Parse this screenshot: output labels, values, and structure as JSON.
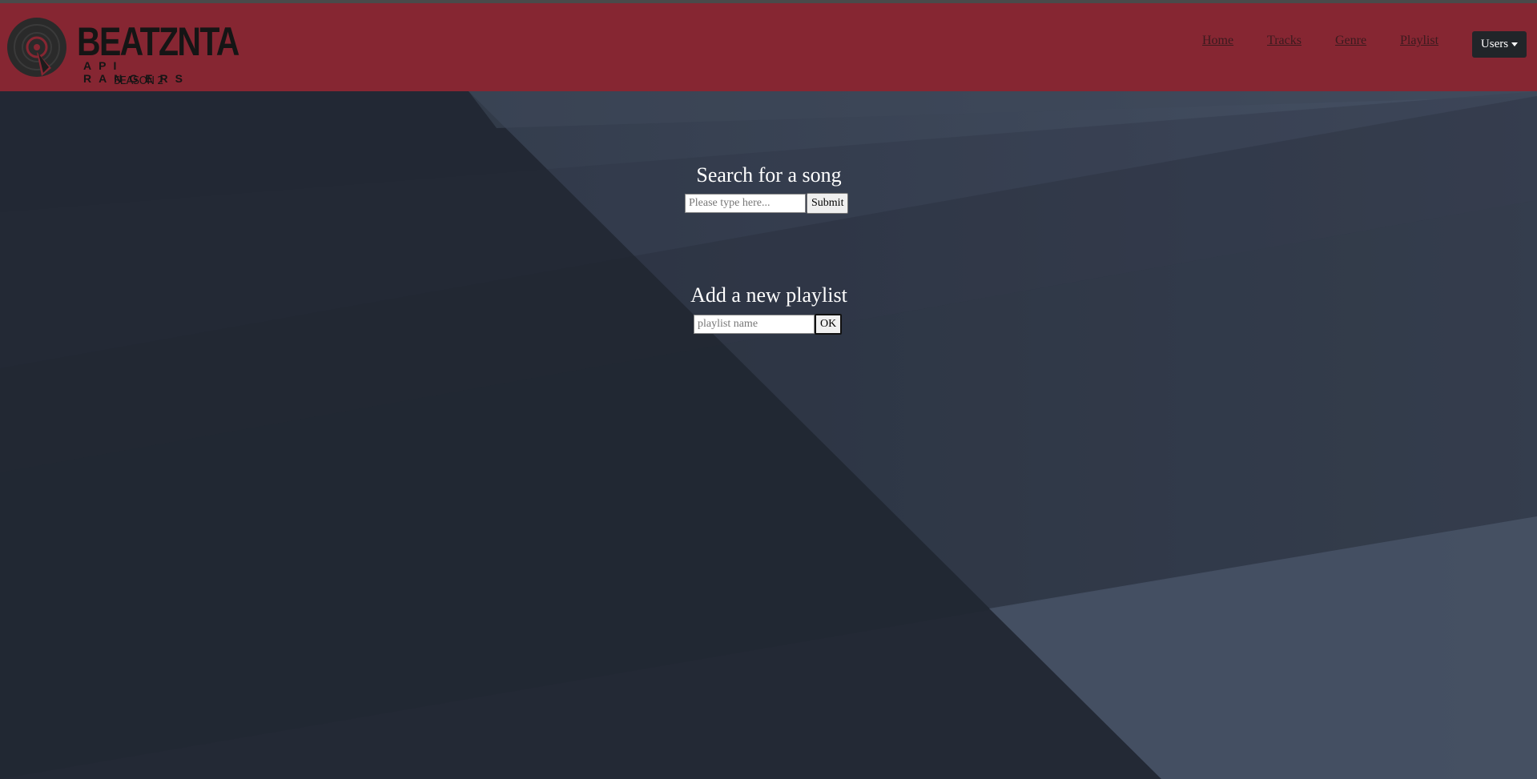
{
  "colors": {
    "navbar": "#862632",
    "background": "#2b3240",
    "users_button": "#212529"
  },
  "logo": {
    "icon": "vinyl-record-icon",
    "wordmark": "BEATZNTA",
    "subtitle": "API RANGERS",
    "season": "SEASON 2"
  },
  "nav": {
    "links": [
      {
        "label": "Home"
      },
      {
        "label": "Tracks"
      },
      {
        "label": "Genre"
      },
      {
        "label": "Playlist"
      }
    ],
    "users_label": "Users"
  },
  "search": {
    "heading": "Search for a song",
    "placeholder": "Please type here...",
    "submit_label": "Submit"
  },
  "playlist": {
    "heading": "Add a new playlist",
    "placeholder": "playlist name",
    "ok_label": "OK"
  }
}
